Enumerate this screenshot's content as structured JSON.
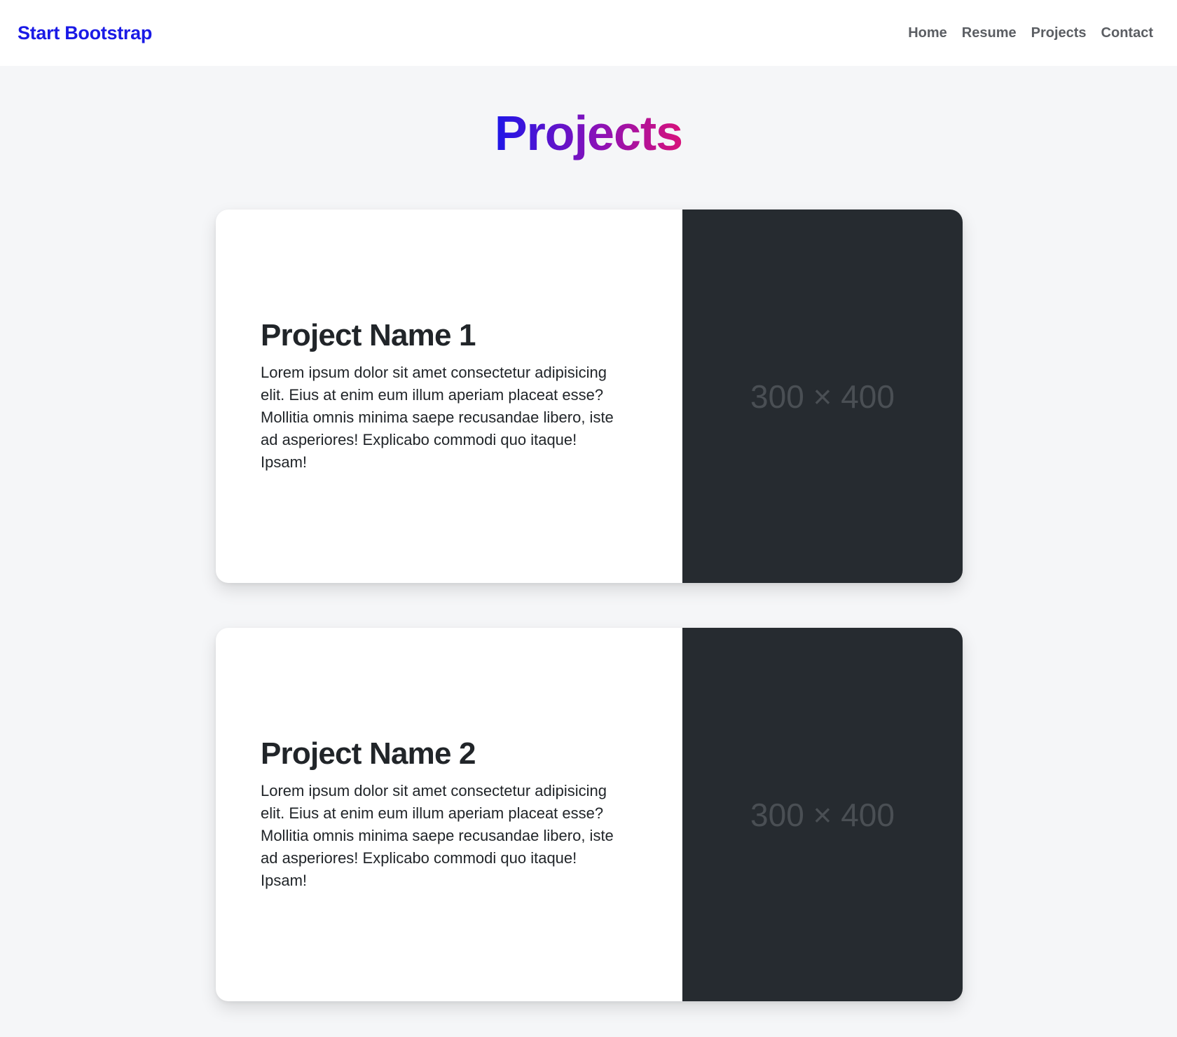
{
  "navbar": {
    "brand": "Start Bootstrap",
    "links": [
      {
        "label": "Home"
      },
      {
        "label": "Resume"
      },
      {
        "label": "Projects"
      },
      {
        "label": "Contact"
      }
    ]
  },
  "page": {
    "title": "Projects",
    "title_gradient": [
      "#1e16e8",
      "#8a12b8",
      "#d8127a"
    ]
  },
  "projects": [
    {
      "name": "Project Name 1",
      "description": "Lorem ipsum dolor sit amet consectetur adipisicing elit. Eius at enim eum illum aperiam placeat esse? Mollitia omnis minima saepe recusandae libero, iste ad asperiores! Explicabo commodi quo itaque! Ipsam!",
      "image_placeholder": "300 × 400"
    },
    {
      "name": "Project Name 2",
      "description": "Lorem ipsum dolor sit amet consectetur adipisicing elit. Eius at enim eum illum aperiam placeat esse? Mollitia omnis minima saepe recusandae libero, iste ad asperiores! Explicabo commodi quo itaque! Ipsam!",
      "image_placeholder": "300 × 400"
    }
  ],
  "colors": {
    "brand": "#1a1ae6",
    "page_background": "#f5f6f8",
    "image_placeholder_bg": "#262b30"
  }
}
